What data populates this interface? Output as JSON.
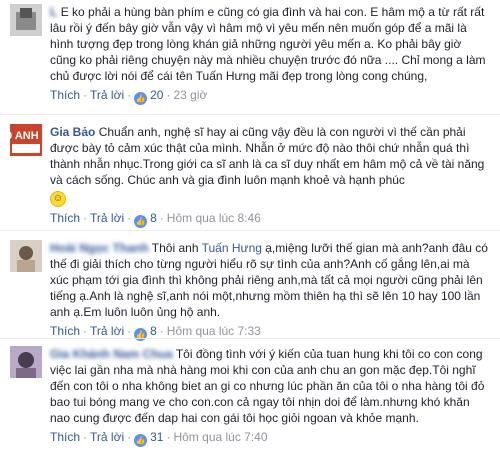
{
  "comments": [
    {
      "author": "L",
      "text": "E ko phải a hùng bàn phím e cũng có gia đình và hai con. E hâm mộ a từ rất rất lâu rồi ý đến bây giờ vẫn vậy vì hâm mộ vì yêu mến nên muốn góp để a mãi là hình tượng đẹp trong lòng khán giả những người yêu mến a. Ko phải bây giờ cũng ko phải riêng chuyện này mà nhiều chuyện trước đó nữa .... Chỉ mong a làm chủ được lời nói để cái tên Tuấn Hưng mãi đẹp trong lòng cong chúng,",
      "actions": {
        "like": "Thích",
        "reply": "Trả lời",
        "likes": "20",
        "time": "23 giờ"
      }
    },
    {
      "author": "Gia Bảo",
      "avatar_text": "500 ANH EM",
      "text": "Chuẩn anh, nghệ sĩ hay ai cũng vậy đều là con người vì thế cần phải được bày tỏ cảm xúc thật của mình. Nhẫn ở mức độ nào thôi chứ nhẫn quá thì thành nhẫn nhục.Trong giới ca sĩ anh là ca sĩ duy nhất em hâm mộ cả về tài năng và cách sống. Chúc anh và gia đình luôn mạnh khoẻ và hạnh phúc",
      "actions": {
        "like": "Thích",
        "reply": "Trả lời",
        "likes": "8",
        "time": "Hôm qua lúc 8:46"
      }
    },
    {
      "author": "Hoài Ngọc Thanh",
      "text_before": "Thôi anh ",
      "mention": "Tuấn Hưng",
      "text": " ạ,miệng lưỡi thế gian mà anh?anh đâu có thế đi giải thích cho từng người hiểu rõ sự tình của anh?Anh cố gắng lên,ai mà xúc phạm tới gia đình thì không phải riêng anh,mà tất cả mọi người cũng phải lên tiếng ạ.Anh là nghệ sĩ,anh nói một,nhưng mồm thiên hạ thì sẽ lên 10 hay 100 lần anh ạ.Em luôn luôn ủng hộ anh.",
      "actions": {
        "like": "Thích",
        "reply": "Trả lời",
        "likes": "8",
        "time": "Hôm qua lúc 7:33"
      }
    },
    {
      "author": "Gia Khánh Nam Chua",
      "text": "Tôi đồng tình với ý kiến của tuan hung khi tôi co con cong việc lai gần nha mà nhà hàng moi khi con của anh chu an gon mặc đẹp.Tôi nghĩ đến con tôi o nha không biet an gi co nhưng lúc phần ăn của tôi o nha hàng tôi đỏ bao tui bóng mang ve cho con.con cả ngay tôi nhịn doi để làm.nhưng khó khăn nao cung được đến dap hai con gái tôi học giỏi ngoan và khỏe mạnh.",
      "actions": {
        "like": "Thích",
        "reply": "Trả lời",
        "likes": "31",
        "time": "Hôm qua lúc 7:40"
      }
    }
  ],
  "colors": {
    "link": "#365899",
    "meta": "#90949c",
    "text": "#1d2129",
    "like_badge": "#5890ff"
  },
  "icons": {
    "like": "thumbs-up-icon",
    "emoji": "smiley-emoji-icon"
  }
}
